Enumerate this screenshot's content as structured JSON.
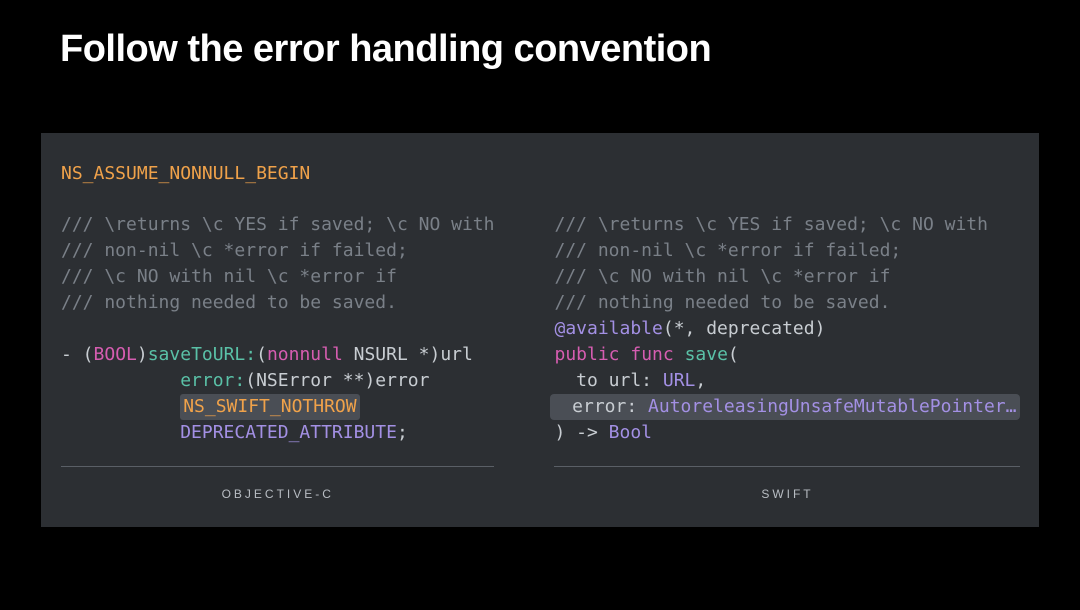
{
  "title": "Follow the error handling convention",
  "macro": "NS_ASSUME_NONNULL_BEGIN",
  "objc": {
    "c1": "/// \\returns \\c YES if saved; \\c NO with",
    "c2": "///          non-nil \\c *error if failed;",
    "c3": "///          \\c NO with nil \\c *error if",
    "c4": "///          nothing needed to be saved.",
    "sig_dash": "- (",
    "sig_bool": "BOOL",
    "sig_close": ")",
    "method1": "saveToURL:",
    "paren1": "(",
    "nonnull": "nonnull",
    "nsurl": " NSURL *)url",
    "method2": "error:",
    "nserror": "(NSError **)error",
    "nothrow": "NS_SWIFT_NOTHROW",
    "deprecated": "DEPRECATED_ATTRIBUTE",
    "semi": ";",
    "label": "OBJECTIVE-C"
  },
  "swift": {
    "c1": "/// \\returns \\c YES if saved; \\c NO with",
    "c2": "///          non-nil \\c *error if failed;",
    "c3": "///          \\c NO with nil \\c *error if",
    "c4": "///          nothing needed to be saved.",
    "avail_at": "@available",
    "avail_args": "(*, deprecated)",
    "public": "public",
    "func": "func",
    "save": "save",
    "open_paren": "(",
    "to_url": "to url: ",
    "url_type": "URL",
    "comma": ",",
    "error_label": "error: ",
    "error_type": "AutoreleasingUnsafeMutablePointer…",
    "close_arrow": ") -> ",
    "bool": "Bool",
    "label": "SWIFT"
  }
}
